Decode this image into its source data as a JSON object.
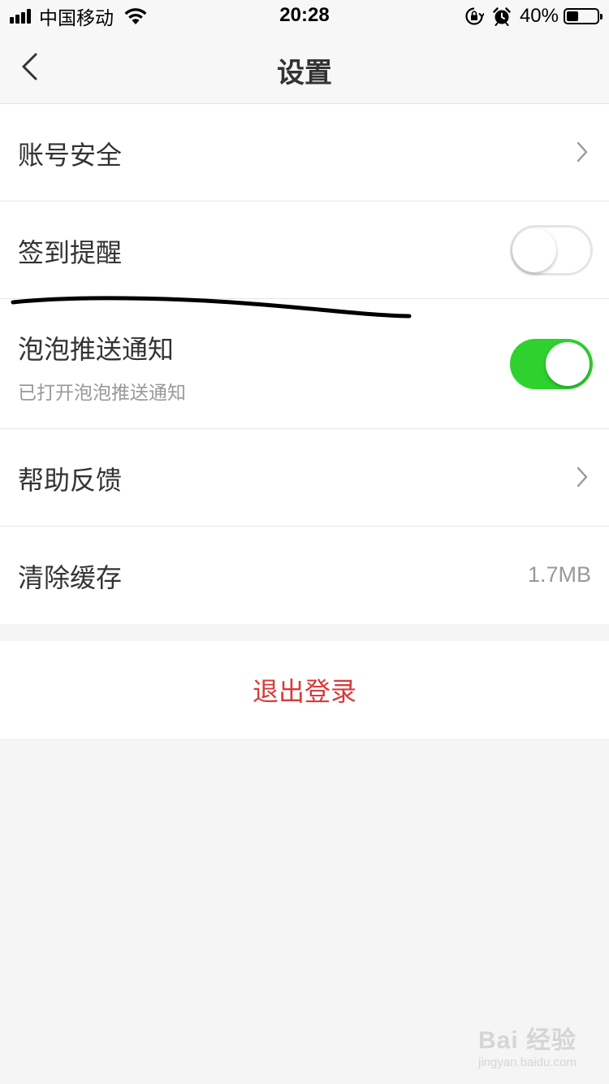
{
  "status_bar": {
    "carrier": "中国移动",
    "time": "20:28",
    "battery_percent_label": "40%",
    "battery_level": 0.4,
    "signal_bars": 4,
    "icons": [
      "signal-icon",
      "wifi-icon",
      "orientation-lock-icon",
      "alarm-icon",
      "battery-icon"
    ]
  },
  "nav": {
    "title": "设置",
    "back_icon": "chevron-left-icon"
  },
  "settings": {
    "account_security": {
      "label": "账号安全",
      "icon": "chevron-right-icon"
    },
    "checkin_reminder": {
      "label": "签到提醒",
      "enabled": false
    },
    "bubble_push": {
      "label": "泡泡推送通知",
      "sublabel": "已打开泡泡推送通知",
      "enabled": true
    },
    "help_feedback": {
      "label": "帮助反馈",
      "icon": "chevron-right-icon"
    },
    "clear_cache": {
      "label": "清除缓存",
      "value": "1.7MB"
    }
  },
  "logout": {
    "label": "退出登录"
  },
  "colors": {
    "toggle_on": "#2fd12f",
    "logout_text": "#d83a3a",
    "background": "#f5f5f5",
    "secondary_text": "#999999"
  },
  "watermark": {
    "logo": "Bai 经验",
    "url": "jingyan.baidu.com"
  }
}
